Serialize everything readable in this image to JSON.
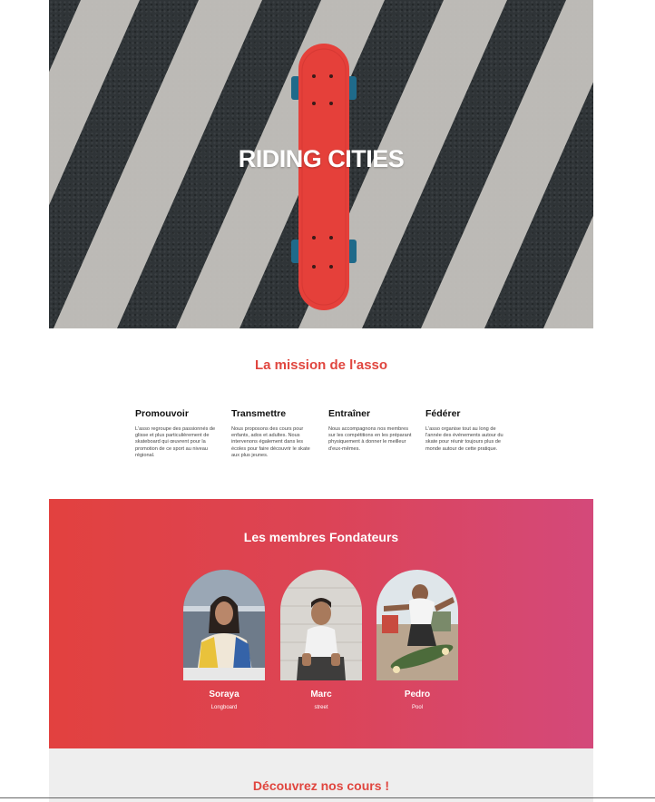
{
  "hero": {
    "title": "RIDING CITIES",
    "image_alt": "red-skateboard-on-crosswalk"
  },
  "mission": {
    "title": "La mission de l'asso",
    "items": [
      {
        "title": "Promouvoir",
        "text": "L'asso regroupe des passionnés de glisse et plus particulièrement de skateboard qui œuvrent pour la promotion de ce sport au niveau régional."
      },
      {
        "title": "Transmettre",
        "text": "Nous proposons des cours pour enfants, ados et adultes. Nous intervenons également dans les écoles pour faire découvrir le skate aux plus jeunes."
      },
      {
        "title": "Entraîner",
        "text": "Nous accompagnons nos membres sur les compétitions en les préparant physiquement à donner le meilleur d'eux-mêmes."
      },
      {
        "title": "Fédérer",
        "text": "L'asso organise tout au long de l'année des événements autour du skate pour réunir toujours plus de monde autour de cette pratique."
      }
    ]
  },
  "founders": {
    "title": "Les membres Fondateurs",
    "members": [
      {
        "name": "Soraya",
        "style": "Longboard"
      },
      {
        "name": "Marc",
        "style": "street"
      },
      {
        "name": "Pedro",
        "style": "Pool"
      }
    ]
  },
  "courses": {
    "title": "Découvrez nos cours !"
  },
  "colors": {
    "accent": "#e0463f",
    "gradient_start": "#e2413f",
    "gradient_end": "#d4497a",
    "board": "#e5403a",
    "asphalt": "#2f3437"
  }
}
